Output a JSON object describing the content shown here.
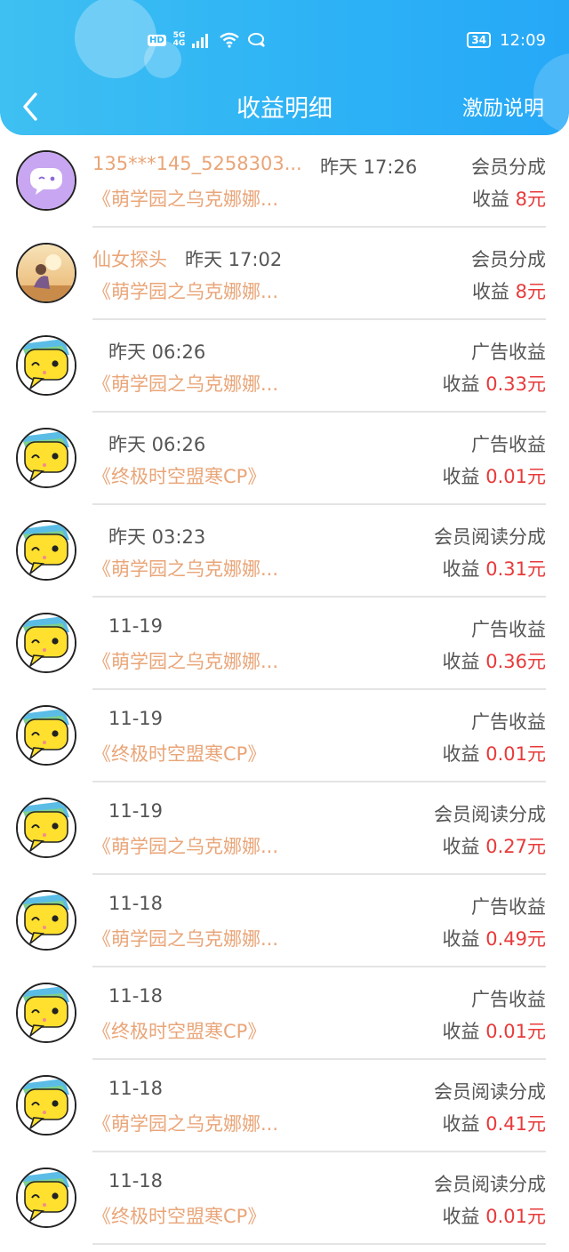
{
  "status_bar": {
    "hd": "HD",
    "network": "5G",
    "network_sub": "4G",
    "battery": "34",
    "time": "12:09"
  },
  "nav": {
    "title": "收益明细",
    "help_label": "激励说明"
  },
  "records": [
    {
      "avatar": "chat-bubble-purple",
      "user": "135***145_5258303...",
      "time": "昨天 17:26",
      "type": "会员分成",
      "book": "《萌学园之乌克娜娜...",
      "income_label": "收益",
      "amount": "8元"
    },
    {
      "avatar": "photo-girl",
      "user": "仙女探头",
      "time": "昨天 17:02",
      "type": "会员分成",
      "book": "《萌学园之乌克娜娜...",
      "income_label": "收益",
      "amount": "8元"
    },
    {
      "avatar": "yellow-mascot",
      "user": "",
      "time": "昨天 06:26",
      "type": "广告收益",
      "book": "《萌学园之乌克娜娜...",
      "income_label": "收益",
      "amount": "0.33元"
    },
    {
      "avatar": "yellow-mascot",
      "user": "",
      "time": "昨天 06:26",
      "type": "广告收益",
      "book": "《终极时空盟寒CP》",
      "income_label": "收益",
      "amount": "0.01元"
    },
    {
      "avatar": "yellow-mascot",
      "user": "",
      "time": "昨天 03:23",
      "type": "会员阅读分成",
      "book": "《萌学园之乌克娜娜...",
      "income_label": "收益",
      "amount": "0.31元"
    },
    {
      "avatar": "yellow-mascot",
      "user": "",
      "time": "11-19",
      "type": "广告收益",
      "book": "《萌学园之乌克娜娜...",
      "income_label": "收益",
      "amount": "0.36元"
    },
    {
      "avatar": "yellow-mascot",
      "user": "",
      "time": "11-19",
      "type": "广告收益",
      "book": "《终极时空盟寒CP》",
      "income_label": "收益",
      "amount": "0.01元"
    },
    {
      "avatar": "yellow-mascot",
      "user": "",
      "time": "11-19",
      "type": "会员阅读分成",
      "book": "《萌学园之乌克娜娜...",
      "income_label": "收益",
      "amount": "0.27元"
    },
    {
      "avatar": "yellow-mascot",
      "user": "",
      "time": "11-18",
      "type": "广告收益",
      "book": "《萌学园之乌克娜娜...",
      "income_label": "收益",
      "amount": "0.49元"
    },
    {
      "avatar": "yellow-mascot",
      "user": "",
      "time": "11-18",
      "type": "广告收益",
      "book": "《终极时空盟寒CP》",
      "income_label": "收益",
      "amount": "0.01元"
    },
    {
      "avatar": "yellow-mascot",
      "user": "",
      "time": "11-18",
      "type": "会员阅读分成",
      "book": "《萌学园之乌克娜娜...",
      "income_label": "收益",
      "amount": "0.41元"
    },
    {
      "avatar": "yellow-mascot",
      "user": "",
      "time": "11-18",
      "type": "会员阅读分成",
      "book": "《终极时空盟寒CP》",
      "income_label": "收益",
      "amount": "0.01元"
    }
  ],
  "colors": {
    "header": "#2fb4f5",
    "accent_text": "#e9a578",
    "amount": "#e83a3a",
    "muted_text": "#555555"
  }
}
